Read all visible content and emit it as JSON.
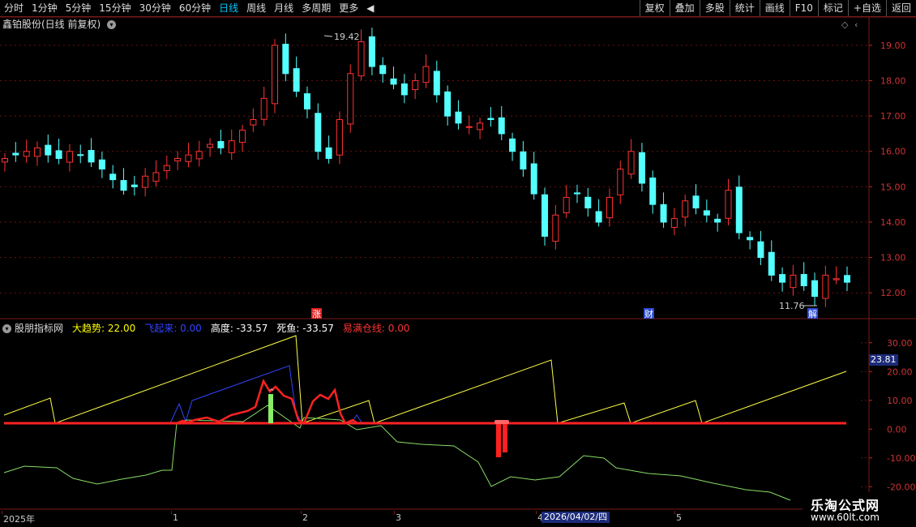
{
  "toolbar": {
    "periods": [
      "分时",
      "1分钟",
      "5分钟",
      "15分钟",
      "30分钟",
      "60分钟",
      "日线",
      "周线",
      "月线",
      "多周期",
      "更多"
    ],
    "active_period": "日线",
    "right_buttons": [
      "复权",
      "叠加",
      "多股",
      "统计",
      "画线",
      "F10",
      "标记",
      "+自选",
      "返回"
    ]
  },
  "main_chart": {
    "title": "鑫铂股份(日线 前复权)",
    "high_label": "19.42",
    "low_label": "11.76",
    "price_ticks": [
      "19.00",
      "18.00",
      "17.00",
      "16.00",
      "15.00",
      "14.00",
      "13.00",
      "12.00"
    ],
    "markers": [
      "涨",
      "财",
      "解"
    ]
  },
  "indicator": {
    "name": "股朋指标网",
    "items": [
      {
        "label": "大趋势:",
        "value": "22.00",
        "color": "#ffff00"
      },
      {
        "label": "飞起来:",
        "value": "0.00",
        "color": "#3344ff"
      },
      {
        "label": "高度:",
        "value": "-33.57",
        "color": "#ffffff"
      },
      {
        "label": "死鱼:",
        "value": "-33.57",
        "color": "#ffffff"
      },
      {
        "label": "易满仓线:",
        "value": "0.00",
        "color": "#ff3333"
      }
    ],
    "ticks": [
      "30.00",
      "20.00",
      "10.00",
      "0.00",
      "-10.00",
      "-20.00"
    ],
    "cursor_value": "23.81"
  },
  "date_axis": {
    "labels": [
      "2025年",
      "1",
      "2",
      "3",
      "4",
      "5"
    ],
    "cursor_date": "2026/04/02/四"
  },
  "watermark": {
    "line1": "乐淘公式网",
    "line2": "www.60lt.com"
  },
  "chart_data": {
    "type": "candlestick",
    "title": "",
    "price_range": [
      11.5,
      19.8
    ],
    "indicator_range": [
      -25,
      35
    ],
    "candles_close": [
      15.8,
      15.9,
      16.0,
      16.1,
      15.9,
      15.8,
      16.0,
      15.9,
      15.7,
      15.5,
      15.2,
      14.9,
      15.0,
      15.3,
      15.4,
      15.6,
      15.8,
      15.9,
      16.0,
      16.2,
      16.1,
      16.3,
      16.6,
      16.9,
      17.5,
      19.0,
      18.2,
      17.7,
      17.2,
      16.0,
      15.8,
      16.9,
      18.2,
      19.1,
      18.4,
      18.2,
      17.9,
      17.6,
      18.0,
      18.4,
      17.6,
      17.0,
      16.8,
      16.7,
      16.8,
      16.9,
      16.5,
      16.0,
      15.5,
      14.8,
      13.6,
      14.2,
      14.7,
      14.8,
      14.4,
      14.0,
      14.7,
      15.5,
      16.0,
      15.1,
      14.5,
      14.0,
      14.1,
      14.6,
      14.4,
      14.2,
      14.0,
      14.9,
      13.7,
      13.5,
      13.0,
      12.5,
      12.3,
      12.5,
      12.2,
      11.9,
      12.5,
      12.4,
      12.3
    ],
    "series": [
      {
        "name": "大趋势",
        "color": "#ffff00"
      },
      {
        "name": "飞起来",
        "color": "#3344ff"
      },
      {
        "name": "易满仓线",
        "color": "#ff3333"
      }
    ]
  }
}
